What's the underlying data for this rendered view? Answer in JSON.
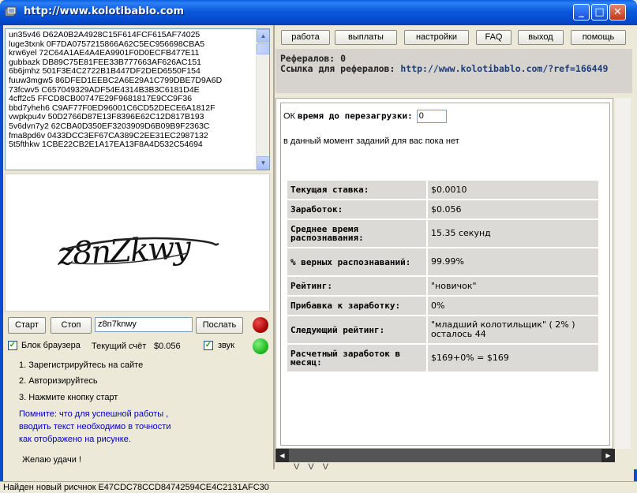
{
  "window": {
    "title": "http://www.kolotibablo.com",
    "buttons": {
      "minimize": "_",
      "maximize": "□",
      "close": "✕"
    }
  },
  "left": {
    "list_lines": [
      "un35v46 D62A0B2A4928C15F614FCF615AF74025",
      "luge3txnk 0F7DA0757215866A62C5EC956698CBA5",
      "krw6yel 72C64A1AE4A4EA9901F0D0ECFB477E11",
      "gubbazk DB89C75E81FEE33B777663AF626AC151",
      "6b6jmhz 501F3E4C2722B1B447DF2DED6550F154",
      "fuuw3mgw5 86DFED1EEBC2A6E29A1C799DBE7D9A6D",
      "73fcwv5 C657049329ADF54E4314B3B3C6181D4E",
      "4cff2c5 FFCD8CB00747E29F9681817E9CC9F36",
      "bbd7yheh6 C9AF77F0ED96001C6CD52DECE6A1812F",
      "vwpkpu4v 50D2766D87E13F8396E62C12D817B193",
      "5v6dvn7y2 62CBA0D350EF3203909D6B09B9F2363C",
      "fma8pd6v 0433DCC3EF67CA389C2EE31EC2987132",
      "5t5fthkw 1CBE22CB2E1A17EA13F8A4D532C54694"
    ],
    "captcha_text": "z8nZkwy",
    "start_label": "Старт",
    "stop_label": "Стоп",
    "answer_value": "z8n7knwy",
    "send_label": "Послать",
    "browser_block_label": "Блок браузера",
    "balance_label": "Текущий счёт",
    "balance_value": "$0.056",
    "sound_label": "звук",
    "steps": [
      "1. Зарегистрируйтесь на сайте",
      "2. Авторизируйтесь",
      "3. Нажмите кнопку старт"
    ],
    "note_lines": [
      "Помните: что для успешной работы ,",
      "вводить текст необходимо в точности",
      "как отображено на рисунке."
    ],
    "good_luck": "Желаю удачи !"
  },
  "tabs": [
    "работа",
    "выплаты",
    "настройки",
    "FAQ",
    "выход",
    "помощь"
  ],
  "referrals": {
    "count_label": "Рефералов: 0",
    "link_label": "Ссылка для рефералов:",
    "link_url": "http://www.kolotibablo.com/?ref=166449"
  },
  "content": {
    "ok": "ОК",
    "reload_label": "время до перезагрузки:",
    "reload_value": "0",
    "no_tasks": "в данный момент заданий для вас пока нет",
    "stats": [
      {
        "key": "Текущая ставка:",
        "value": "$0.0010"
      },
      {
        "key": "Заработок:",
        "value": "$0.056"
      },
      {
        "key": "Среднее время распознавания:",
        "value": "15.35 секунд"
      },
      {
        "key": "% верных распознаваний:",
        "value": "99.99%"
      },
      {
        "key": "Рейтинг:",
        "value": "\"новичок\""
      },
      {
        "key": "Прибавка к заработку:",
        "value": "0%"
      },
      {
        "key": "Следующий рейтинг:",
        "value": "\"младший колотильщик\" ( 2% ) осталось 44"
      },
      {
        "key": "Расчетный заработок в месяц:",
        "value": "$169+0% = $169"
      }
    ]
  },
  "divider_mark": "V V V",
  "status": "Найден новый рисчнок E47CDC78CCD84742594CE4C2131AFC30",
  "colors": {
    "titlebar": "#0a58dc",
    "panel_bg": "#ece9d8",
    "stat_cell": "#dcdad6",
    "ref_link": "#1e3c78",
    "note_text": "#0000c0",
    "indicator_red": "#c00000",
    "indicator_green": "#2ec82e"
  }
}
